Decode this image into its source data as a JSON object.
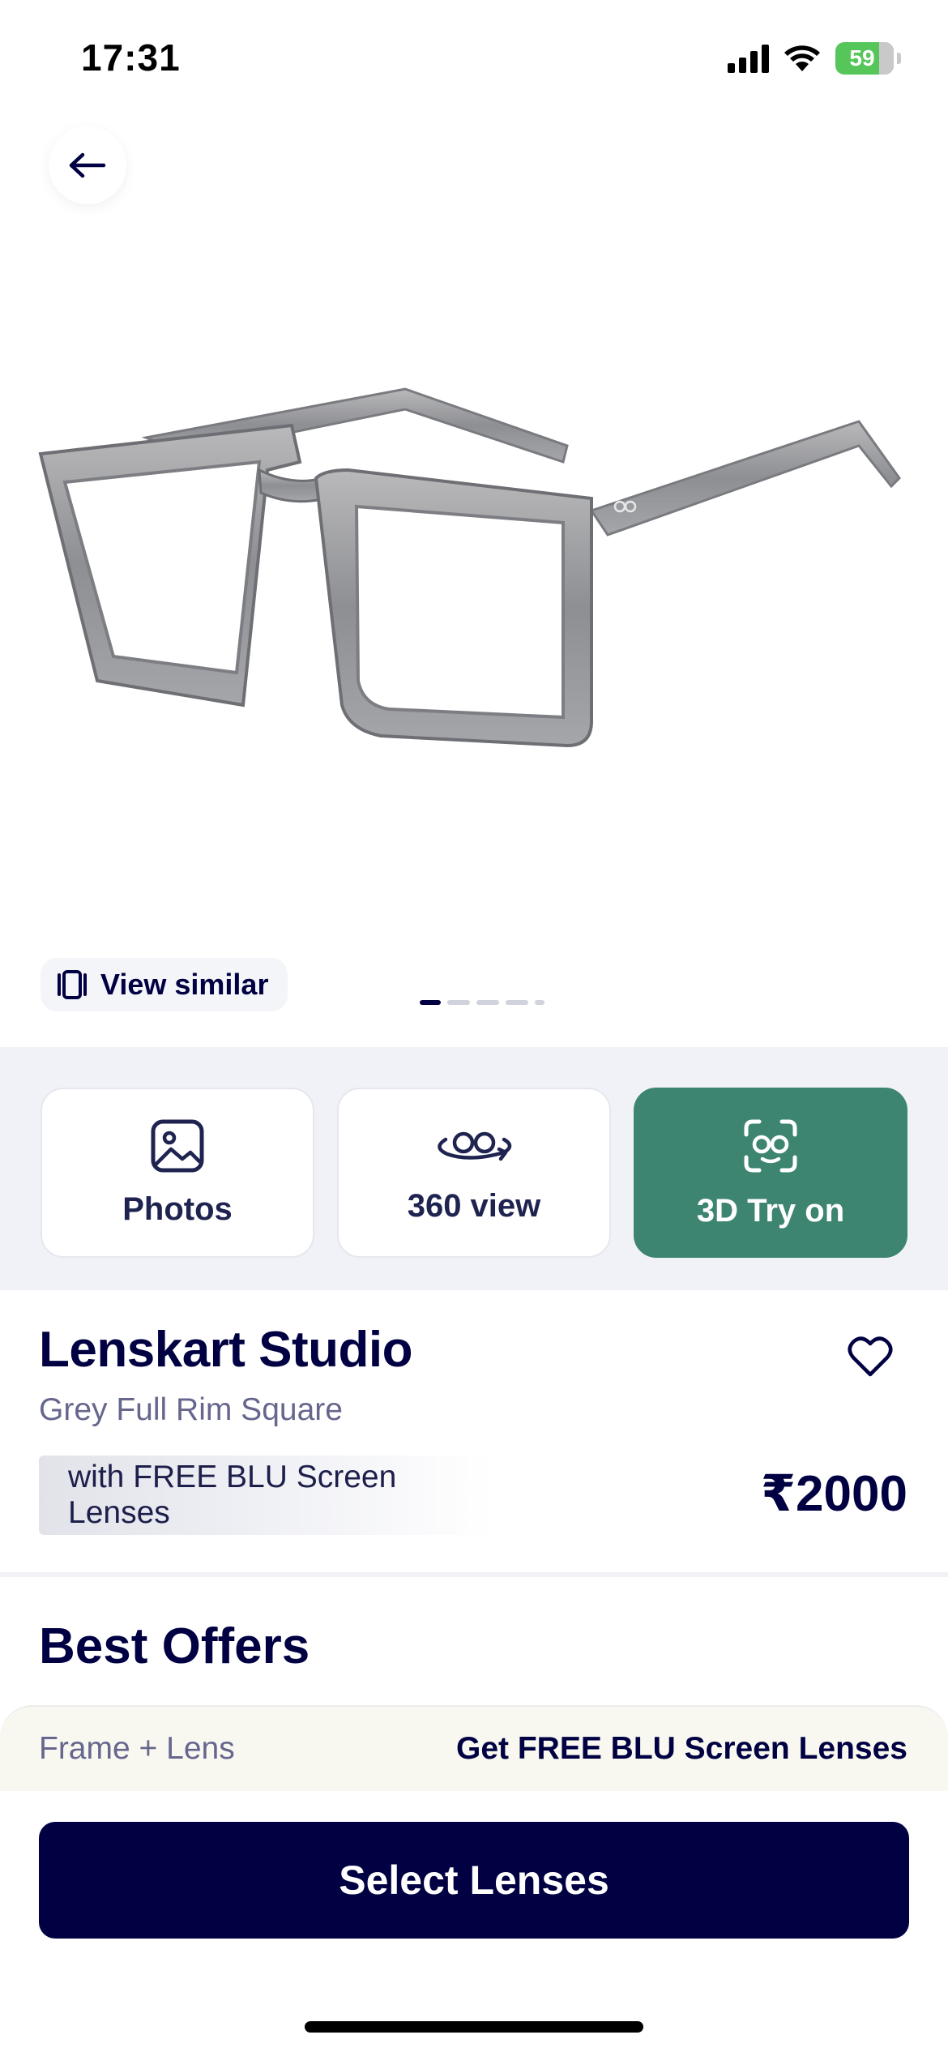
{
  "status_bar": {
    "time": "17:31",
    "battery": "59"
  },
  "product": {
    "image_icon": "eyeglasses-grey-square",
    "view_similar_label": "View similar",
    "carousel": {
      "total": 5,
      "active": 1
    }
  },
  "media_tabs": [
    {
      "label": "Photos",
      "icon": "image-icon"
    },
    {
      "label": "360 view",
      "icon": "rotate-glasses-icon"
    },
    {
      "label": "3D Try on",
      "icon": "face-scan-glasses-icon",
      "active": true
    }
  ],
  "info": {
    "brand": "Lenskart Studio",
    "subtitle": "Grey Full Rim Square",
    "lens_note": "with FREE BLU Screen Lenses",
    "price": "₹2000"
  },
  "offers": {
    "title": "Best Offers",
    "strip_left": "Frame + Lens",
    "strip_right": "Get FREE BLU Screen Lenses"
  },
  "cta": {
    "label": "Select Lenses"
  },
  "colors": {
    "navy": "#000042",
    "green": "#3d8570",
    "battery": "#56c65a"
  }
}
